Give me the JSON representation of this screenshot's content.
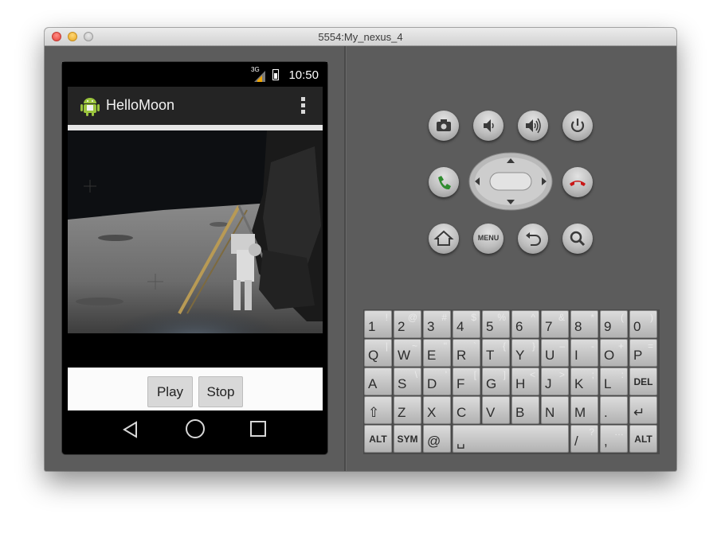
{
  "window": {
    "title": "5554:My_nexus_4"
  },
  "phone": {
    "status_bar": {
      "network": "3G",
      "time": "10:50"
    },
    "action_bar": {
      "app_title": "HelloMoon"
    },
    "buttons": {
      "play": "Play",
      "stop": "Stop"
    }
  },
  "hardware_buttons": {
    "row1": [
      "camera-icon",
      "volume-down-icon",
      "volume-up-icon",
      "power-icon"
    ],
    "row2": [
      "call-icon",
      "dpad",
      "end-call-icon"
    ],
    "row3": [
      "home-icon",
      "menu-button",
      "back-icon",
      "search-icon"
    ],
    "menu_label": "MENU"
  },
  "keyboard": {
    "rows": [
      [
        [
          "1",
          "!"
        ],
        [
          "2",
          "@"
        ],
        [
          "3",
          "#"
        ],
        [
          "4",
          "$"
        ],
        [
          "5",
          "%"
        ],
        [
          "6",
          "^"
        ],
        [
          "7",
          "&"
        ],
        [
          "8",
          "*"
        ],
        [
          "9",
          "("
        ],
        [
          "0",
          ")"
        ]
      ],
      [
        [
          "Q",
          "|"
        ],
        [
          "W",
          "~"
        ],
        [
          "E",
          "\""
        ],
        [
          "R",
          "`"
        ],
        [
          "T",
          "{"
        ],
        [
          "Y",
          "}"
        ],
        [
          "U",
          "–"
        ],
        [
          "I",
          "-"
        ],
        [
          "O",
          "+"
        ],
        [
          "P",
          "="
        ]
      ],
      [
        [
          "A",
          ""
        ],
        [
          "S",
          "\\"
        ],
        [
          "D",
          "'"
        ],
        [
          "F",
          "["
        ],
        [
          "G",
          "]"
        ],
        [
          "H",
          "<"
        ],
        [
          "J",
          ">"
        ],
        [
          "K",
          ";"
        ],
        [
          "L",
          ":"
        ],
        [
          "DEL",
          ""
        ]
      ],
      [
        [
          "⇧",
          ""
        ],
        [
          "Z",
          ""
        ],
        [
          "X",
          ""
        ],
        [
          "C",
          ""
        ],
        [
          "V",
          ""
        ],
        [
          "B",
          ""
        ],
        [
          "N",
          ""
        ],
        [
          "M",
          ""
        ],
        [
          ".",
          ""
        ],
        [
          "↵",
          ""
        ]
      ],
      [
        [
          "ALT",
          ""
        ],
        [
          "SYM",
          ""
        ],
        [
          "@",
          ""
        ],
        [
          "␣",
          ""
        ],
        [
          "/",
          "?"
        ],
        [
          ",",
          "…"
        ],
        [
          "ALT",
          ""
        ]
      ]
    ]
  }
}
